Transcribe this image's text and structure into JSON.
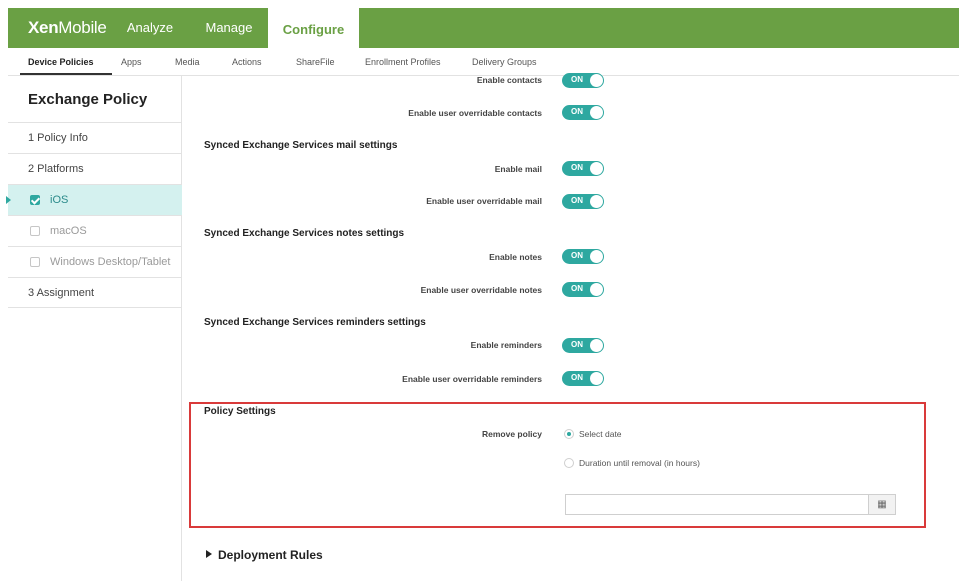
{
  "app": {
    "logo_bold": "Xen",
    "logo_light": "Mobile"
  },
  "topnav": [
    {
      "label": "Analyze",
      "active": false
    },
    {
      "label": "Manage",
      "active": false
    },
    {
      "label": "Configure",
      "active": true
    }
  ],
  "subnav": [
    {
      "label": "Device Policies",
      "active": true
    },
    {
      "label": "Apps"
    },
    {
      "label": "Media"
    },
    {
      "label": "Actions"
    },
    {
      "label": "ShareFile"
    },
    {
      "label": "Enrollment Profiles"
    },
    {
      "label": "Delivery Groups"
    }
  ],
  "sidebar": {
    "title": "Exchange Policy",
    "items": [
      {
        "label": "1  Policy Info"
      },
      {
        "label": "2  Platforms"
      },
      {
        "label": "iOS",
        "checked": true,
        "selected": true
      },
      {
        "label": "macOS",
        "checked": false
      },
      {
        "label": "Windows Desktop/Tablet",
        "checked": false
      },
      {
        "label": "3  Assignment"
      }
    ]
  },
  "toggle_on_label": "ON",
  "settings": {
    "contacts": {
      "enable": "Enable contacts",
      "override": "Enable user overridable contacts"
    },
    "mail": {
      "heading": "Synced Exchange Services mail settings",
      "enable": "Enable mail",
      "override": "Enable user overridable mail"
    },
    "notes": {
      "heading": "Synced Exchange Services notes settings",
      "enable": "Enable notes",
      "override": "Enable user overridable notes"
    },
    "reminders": {
      "heading": "Synced Exchange Services reminders settings",
      "enable": "Enable reminders",
      "override": "Enable user overridable reminders"
    }
  },
  "policy_settings": {
    "heading": "Policy Settings",
    "remove_label": "Remove policy",
    "option_date": "Select date",
    "option_duration": "Duration until removal (in hours)",
    "selected_option": "Select date",
    "date_value": ""
  },
  "deployment_rules": "Deployment Rules",
  "colors": {
    "brand": "#6aa044",
    "accent": "#2ea8a0",
    "highlight": "#d93a3a"
  }
}
